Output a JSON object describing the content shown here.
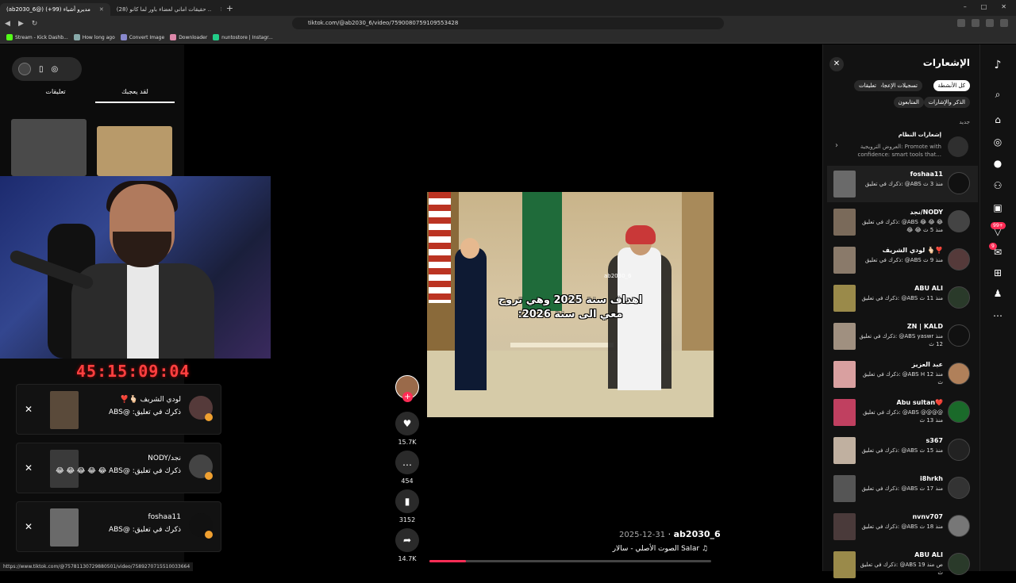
{
  "browser": {
    "tabs": [
      {
        "label": "(ab2030_6@) مديرو أشياء (99+)",
        "active": true
      },
      {
        "label": "(28) حقيقات اماني لعضاء باور لما كانو ..",
        "active": false
      }
    ],
    "new_tab": "+",
    "window_controls": [
      "–",
      "□",
      "✕"
    ],
    "url": "tiktok.com/@ab2030_6/video/7590080759109553428",
    "bookmarks": [
      {
        "label": "Stream - Kick Dashb...",
        "color": "#53fc18"
      },
      {
        "label": "How long ago",
        "color": "#8aa"
      },
      {
        "label": "Convert Image",
        "color": "#88c"
      },
      {
        "label": "Downloader",
        "color": "#d8a"
      },
      {
        "label": "nuntostore | Instagr...",
        "color": "#2c8"
      }
    ],
    "status_url": "https://www.tiktok.com/@75781130729880501/video/7589270715510033664"
  },
  "left_panel": {
    "tabs": [
      {
        "label": "لقد يعجبك",
        "active": true
      },
      {
        "label": "تعليقات",
        "active": false
      }
    ]
  },
  "stream": {
    "timer": "45:15:09:04"
  },
  "popup_notifications": [
    {
      "name": "لودي الشريف 🫰🏻❣️",
      "text": "ذكرك في تعليق: @ABS",
      "close": "✕"
    },
    {
      "name": "نجد/NODY",
      "text": "ذكرك في تعليق: @ABS 😂 😂 😂 😂 😂",
      "close": "✕"
    },
    {
      "name": "foshaa11",
      "text": "ذكرك في تعليق: @ABS",
      "close": "✕"
    }
  ],
  "video": {
    "watermark": "ab2030_6",
    "caption_line1": "اهداف سنة 2025 وهي تروح",
    "caption_line2": "معي الى سنة 2026:",
    "progress": 0.13,
    "author": "ab2030_6",
    "date": "2025-12-31",
    "sound_icon": "♫",
    "sound": "Salar الصوت الأصلي - سالار"
  },
  "actions": {
    "follow": "+",
    "likes": "15.7K",
    "comments": "454",
    "saves": "3152",
    "shares": "14.7K"
  },
  "notifications": {
    "title": "الإشعارات",
    "close": "✕",
    "filters": [
      {
        "label": "كل الأنشطة",
        "active": true
      },
      {
        "label": "تسجيلات الإعجاب",
        "active": false
      },
      {
        "label": "تعليقات",
        "active": false
      },
      {
        "label": "الذكر والإشارات",
        "active": false
      },
      {
        "label": "المتابعون",
        "active": false
      }
    ],
    "section": "جديد",
    "system": {
      "title": "إشعارات النظام",
      "body": "العروض الترويجية: Promote with confidence: smart tools that..."
    },
    "items": [
      {
        "name": "foshaa11",
        "body": "ذكرك في تعليق: @ABS منذ 3 ث",
        "thumb": "#6a6a6a",
        "avatar": "#111"
      },
      {
        "name": "نجد/NODY",
        "body": "ذكرك في تعليق: @ABS 😂 😂 😂 😂 😂 منذ 5 ث",
        "thumb": "#7a6a5a",
        "avatar": "#444"
      },
      {
        "name": "لودي الشريف 🫰🏻❣️",
        "body": "ذكرك في تعليق: @ABS منذ 9 ث",
        "thumb": "#8a7a6a",
        "avatar": "#553a3a"
      },
      {
        "name": "ABU ALI",
        "body": "ذكرك في تعليق: @ABS منذ 11 ث",
        "thumb": "#9a8a4a",
        "avatar": "#2a3a2a"
      },
      {
        "name": "ZN | KALD",
        "body": "ذكرك في تعليق: @ABS yaswr منذ 12 ث",
        "thumb": "#a09080",
        "avatar": "#111"
      },
      {
        "name": "عبد العزيز",
        "body": "ذكرك في تعليق: @ABS H منذ 12 ث",
        "thumb": "#d9a0a0",
        "avatar": "#b0805a"
      },
      {
        "name": "Abu sultan❤️",
        "body": "ذكرك في تعليق: @ABS @@@@ منذ 13 ث",
        "thumb": "#c04060",
        "avatar": "#1a6a2a"
      },
      {
        "name": "s367",
        "body": "ذكرك في تعليق: @ABS منذ 15 ث",
        "thumb": "#c0b0a0",
        "avatar": "#222"
      },
      {
        "name": "i8hrkh",
        "body": "ذكرك في تعليق: @ABS منذ 17 ث",
        "thumb": "#555",
        "avatar": "#333"
      },
      {
        "name": "nvnv707",
        "body": "ذكرك في تعليق: @ABS منذ 18 ث",
        "thumb": "#4a3a3a",
        "avatar": "#777"
      },
      {
        "name": "ABU ALI",
        "body": "ذكرك في تعليق: @ABS ص منذ 19 ث",
        "thumb": "#9a8a4a",
        "avatar": "#2a3a2a"
      }
    ]
  },
  "rail": {
    "friends_badge": "99+",
    "inbox_badge": "9"
  }
}
